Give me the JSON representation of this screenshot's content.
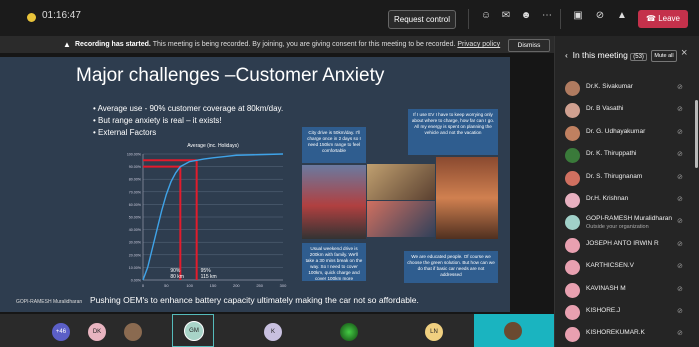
{
  "topbar": {
    "timer": "01:16:47",
    "request_control": "Request control",
    "leave": "Leave"
  },
  "banner": {
    "bold": "Recording has started.",
    "text": "This meeting is being recorded. By joining, you are giving consent for this meeting to be recorded.",
    "link": "Privacy policy",
    "dismiss": "Dismiss"
  },
  "slide": {
    "title": "Major challenges –Customer Anxiety",
    "bullets": [
      "Average use - 90% customer coverage at 80km/day.",
      "But range anxiety is real – it exists!",
      "External Factors"
    ],
    "bubble_top_left": "City drive is 50km/day. I'll charge once in 2 days so I need 150km range to feel comfortable",
    "bubble_top_right": "If I use EV I have to keep worrying only about where to charge, how far can I go. All my energy is spent on planning the vehicle and not the vacation",
    "bubble_bottom_left": "Usual weekend drive is 200km with family. We'll take a 30 mins break on the way. So I need to cover 100km, quick charge and cover 100km more",
    "bubble_bottom_right": "We are educated people. Of course we choose the green solution. But how can we do that if basic car needs are not addressed",
    "bottom_text": "Pushing OEM's to enhance battery capacity ultimately making the car not so affordable.",
    "presenter_label": "GOPI-RAMESH Muralidharan"
  },
  "chart_data": {
    "type": "line",
    "title": "Average (inc. Holidays)",
    "x": [
      0,
      10,
      20,
      30,
      40,
      50,
      60,
      70,
      80,
      90,
      100,
      115,
      130,
      150,
      175,
      200,
      250,
      300
    ],
    "y": [
      0,
      10,
      25,
      40,
      55,
      68,
      78,
      85,
      90,
      92,
      94,
      95,
      96,
      97,
      98,
      99,
      99.5,
      100
    ],
    "xlim": [
      0,
      300
    ],
    "ylim": [
      0,
      100
    ],
    "x_ticks": [
      "0",
      "50",
      "100",
      "150",
      "200",
      "250",
      "300"
    ],
    "y_ticks": [
      "0.00%",
      "10.00%",
      "20.00%",
      "30.00%",
      "40.00%",
      "50.00%",
      "60.00%",
      "70.00%",
      "80.00%",
      "90.00%",
      "100.00%"
    ],
    "annotations": [
      {
        "label": "90%",
        "sub": "80 km",
        "x": 80,
        "y": 90
      },
      {
        "label": "95%",
        "sub": "115 km",
        "x": 115,
        "y": 95
      }
    ],
    "grid": true,
    "colors": {
      "line": "#3fa3e8",
      "markers": "#e21b2c",
      "grid": "#5b6c80"
    }
  },
  "gallery": {
    "tiles": [
      {
        "initials": "+46",
        "color": "#5b5fc7"
      },
      {
        "initials": "DK",
        "color": "#e8b4c0"
      },
      {
        "initials": "",
        "color": "#8a6a50"
      },
      {
        "initials": "GM",
        "color": "#a8d4c8"
      },
      {
        "initials": "K",
        "color": "#c8c0e0"
      },
      {
        "initials": "",
        "color": "#2a2a2a"
      },
      {
        "initials": "LN",
        "color": "#f0d080"
      },
      {
        "initials": "",
        "color": "#1ab4c0"
      }
    ]
  },
  "panel": {
    "heading": "In this meeting",
    "count": "(53)",
    "mute_all": "Mute all",
    "participants": [
      {
        "name": "Dr.K. Sivakumar",
        "sub": "",
        "color": "#b07b60"
      },
      {
        "name": "Dr. B Vasathi",
        "sub": "",
        "color": "#d0a090"
      },
      {
        "name": "Dr. G. Udhayakumar",
        "sub": "",
        "color": "#c08060"
      },
      {
        "name": "Dr. K. Thiruppathi",
        "sub": "",
        "color": "#3a7a3a"
      },
      {
        "name": "Dr. S. Thirugnanam",
        "sub": "",
        "color": "#d07060"
      },
      {
        "name": "Dr.H. Krishnan",
        "sub": "",
        "color": "#e8b0c0"
      },
      {
        "name": "GOPI-RAMESH Muralidharan",
        "sub": "Outside your organization",
        "color": "#a0d0c8"
      },
      {
        "name": "JOSEPH ANTO IRWIN R",
        "sub": "",
        "color": "#e8a0b0"
      },
      {
        "name": "KARTHICSEN.V",
        "sub": "",
        "color": "#e8a0b0"
      },
      {
        "name": "KAVINASH M",
        "sub": "",
        "color": "#e8a0b0"
      },
      {
        "name": "KISHORE.J",
        "sub": "",
        "color": "#e8a0b0"
      },
      {
        "name": "KISHOREKUMAR.K",
        "sub": "",
        "color": "#e8a0b0"
      }
    ]
  }
}
